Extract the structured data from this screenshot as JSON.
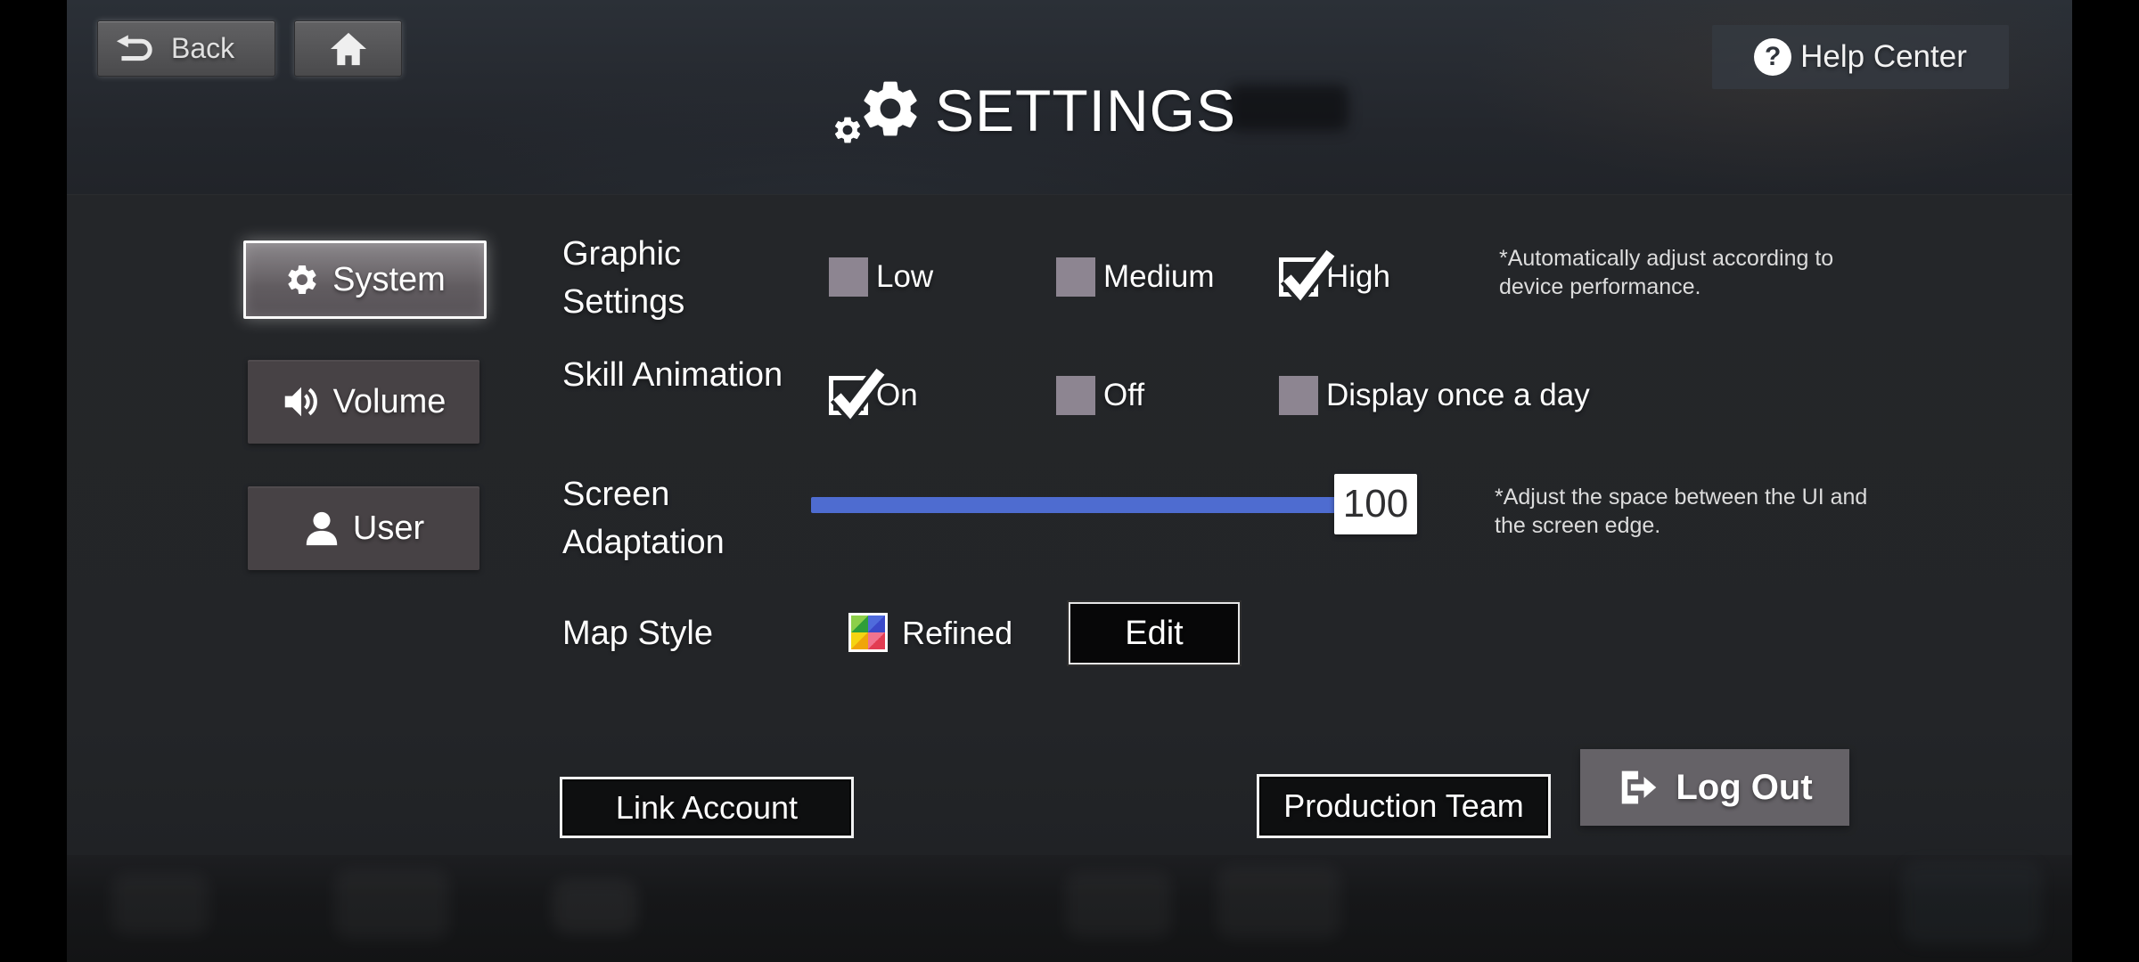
{
  "header": {
    "back_label": "Back",
    "title": "SETTINGS",
    "help_center_label": "Help Center",
    "help_glyph": "?"
  },
  "sidebar": {
    "items": [
      {
        "label": "System",
        "selected": true
      },
      {
        "label": "Volume",
        "selected": false
      },
      {
        "label": "User",
        "selected": false
      }
    ]
  },
  "settings": {
    "graphic": {
      "label": "Graphic Settings",
      "options": [
        {
          "label": "Low",
          "checked": false
        },
        {
          "label": "Medium",
          "checked": false
        },
        {
          "label": "High",
          "checked": true
        }
      ],
      "note": "*Automatically adjust according to device performance."
    },
    "skill": {
      "label": "Skill Animation",
      "options": [
        {
          "label": "On",
          "checked": true
        },
        {
          "label": "Off",
          "checked": false
        },
        {
          "label": "Display once a day",
          "checked": false
        }
      ]
    },
    "screen": {
      "label": "Screen Adaptation",
      "value": "100",
      "note": "*Adjust the space between the UI and the screen edge."
    },
    "map": {
      "label": "Map Style",
      "style_name": "Refined",
      "edit_label": "Edit"
    }
  },
  "footer": {
    "link_account_label": "Link Account",
    "production_team_label": "Production Team",
    "log_out_label": "Log Out"
  },
  "colors": {
    "accent_blue": "#4e6cd0",
    "checkbox_unchecked": "#8d8591",
    "panel": "#232528",
    "selected_button_border": "#fafafa",
    "logout_button": "#656267"
  },
  "icons": {
    "back": "undo-arrow",
    "home": "house",
    "title": "double-gear",
    "help": "question-circle",
    "system": "gear",
    "volume": "speaker-waves",
    "user": "person",
    "map_style": "colored-quadrants",
    "checked": "checkmark",
    "logout": "door-arrow-right"
  }
}
